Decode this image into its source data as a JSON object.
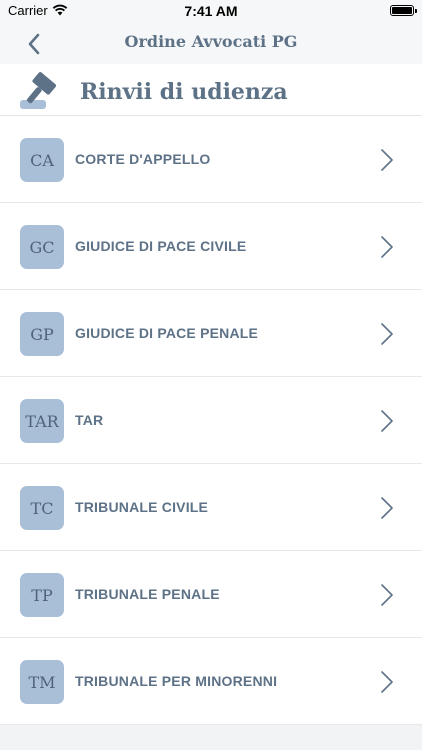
{
  "status": {
    "carrier": "Carrier",
    "time": "7:41 AM"
  },
  "nav": {
    "title": "Ordine Avvocati PG"
  },
  "header": {
    "title": "Rinvii di udienza"
  },
  "courts": [
    {
      "code": "CA",
      "label": "CORTE D'APPELLO"
    },
    {
      "code": "GC",
      "label": "GIUDICE DI PACE CIVILE"
    },
    {
      "code": "GP",
      "label": "GIUDICE DI PACE PENALE"
    },
    {
      "code": "TAR",
      "label": "TAR"
    },
    {
      "code": "TC",
      "label": "TRIBUNALE CIVILE"
    },
    {
      "code": "TP",
      "label": "TRIBUNALE PENALE"
    },
    {
      "code": "TM",
      "label": "TRIBUNALE PER MINORENNI"
    }
  ],
  "colors": {
    "accent": "#5e7287",
    "badge": "#a9bfd8"
  },
  "icons": {
    "back": "chevron-left-icon",
    "header": "gavel-icon",
    "row": "chevron-right-icon"
  }
}
